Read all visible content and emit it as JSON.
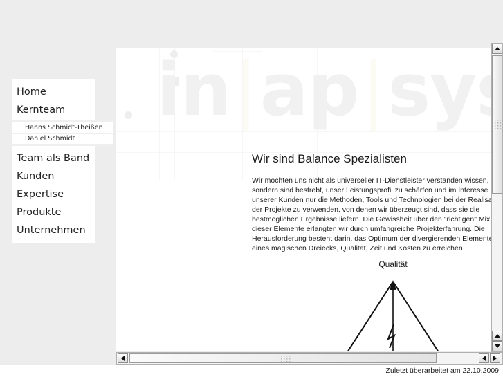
{
  "watermark": {
    "logo_part1": "in",
    "separator": "|",
    "logo_part2": "ap",
    "logo_part3": "sys"
  },
  "nav": {
    "items": [
      {
        "label": "Home"
      },
      {
        "label": "Kernteam"
      },
      {
        "label": "Team als Band"
      },
      {
        "label": "Kunden"
      },
      {
        "label": "Expertise"
      },
      {
        "label": "Produkte"
      },
      {
        "label": "Unternehmen"
      }
    ],
    "subitems": [
      {
        "label": "Hanns Schmidt-Theißen"
      },
      {
        "label": "Daniel Schmidt"
      }
    ]
  },
  "article": {
    "heading": "Wir sind Balance Spezialisten",
    "body": "Wir möchten uns nicht als universeller IT-Dienstleister verstanden wissen, sondern sind bestrebt, unser Leistungsprofil zu schärfen und im Interesse unserer Kunden nur die Methoden, Tools und Technologien bei der Realisation der Projekte zu verwenden, von denen wir überzeugt sind, dass sie die bestmöglichen Ergebnisse liefern. Die Gewissheit über den \"richtigen\" Mix dieser Elemente erlangten wir durch umfangreiche Projekterfahrung. Die Herausforderung besteht darin, das Optimum der divergierenden Elemente eines magischen Dreiecks, Qualität, Zeit und Kosten zu erreichen."
  },
  "diagram": {
    "label_top": "Qualität"
  },
  "scrollbars": {
    "vertical_up_icon": "arrow-up-icon",
    "vertical_down_icon": "arrow-down-icon",
    "horizontal_left_icon": "arrow-left-icon",
    "horizontal_right_icon": "arrow-right-icon"
  },
  "statusbar": {
    "text": "Zuletzt überarbeitet am 22.10.2009"
  },
  "colors": {
    "page_background": "#ededed",
    "content_background": "#ffffff",
    "watermark": "#f1f1f1",
    "text": "#1d1d1d"
  }
}
